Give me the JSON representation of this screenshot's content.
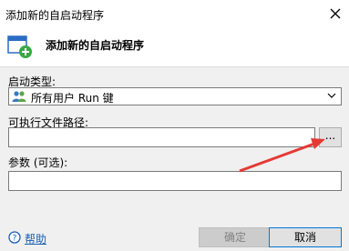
{
  "window": {
    "title": "添加新的自启动程序",
    "close_icon": "close-icon"
  },
  "header": {
    "icon": "new-window-icon",
    "title": "添加新的自启动程序"
  },
  "form": {
    "startup_type_label": "启动类型:",
    "startup_type_value": "所有用户 Run 键",
    "startup_type_icon": "users-icon",
    "exe_path_label": "可执行文件路径:",
    "exe_path_value": "",
    "browse_label": "...",
    "params_label": "参数 (可选):",
    "params_value": ""
  },
  "footer": {
    "help_label": "帮助",
    "help_icon": "help-icon",
    "ok_label": "确定",
    "ok_enabled": false,
    "cancel_label": "取消"
  },
  "annotation": {
    "arrow_color": "#e53935"
  },
  "colors": {
    "accent": "#0078d7",
    "panel_bg": "#f0f0f0"
  }
}
